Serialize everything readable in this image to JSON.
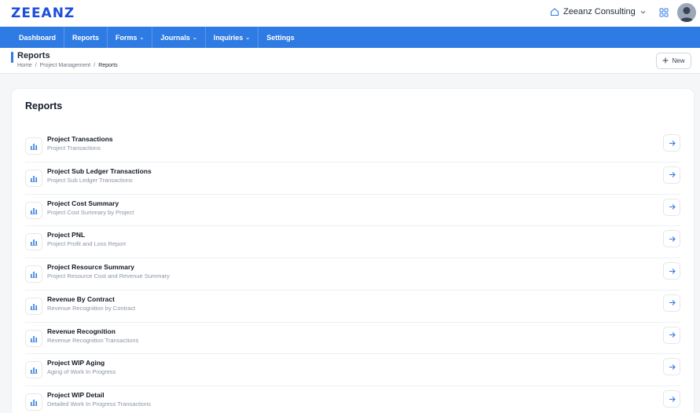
{
  "app": {
    "logo": "ZEEANZ"
  },
  "header": {
    "company_name": "Zeeanz Consulting"
  },
  "nav": {
    "items": [
      {
        "label": "Dashboard",
        "dropdown": false
      },
      {
        "label": "Reports",
        "dropdown": false
      },
      {
        "label": "Forms",
        "dropdown": true
      },
      {
        "label": "Journals",
        "dropdown": true
      },
      {
        "label": "Inquiries",
        "dropdown": true
      },
      {
        "label": "Settings",
        "dropdown": false
      }
    ]
  },
  "page": {
    "title": "Reports",
    "breadcrumb": [
      "Home",
      "Project Management",
      "Reports"
    ],
    "breadcrumb_separator": "/",
    "new_button_label": "New"
  },
  "card": {
    "title": "Reports",
    "reports": [
      {
        "title": "Project Transactions",
        "subtitle": "Project Transactions"
      },
      {
        "title": "Project Sub Ledger Transactions",
        "subtitle": "Project Sub Ledger Transactions"
      },
      {
        "title": "Project Cost Summary",
        "subtitle": "Project Cost Summary by Project"
      },
      {
        "title": "Project PNL",
        "subtitle": "Project Profit and Loss Report"
      },
      {
        "title": "Project Resource Summary",
        "subtitle": "Project Resource Cost and Revenue Summary"
      },
      {
        "title": "Revenue By Contract",
        "subtitle": "Revenue Recognition by Contract"
      },
      {
        "title": "Revenue Recognition",
        "subtitle": "Revenue Recognition Transactions"
      },
      {
        "title": "Project WIP Aging",
        "subtitle": "Aging of Work In Progress"
      },
      {
        "title": "Project WIP Detail",
        "subtitle": "Detailed Work In Progress Transactions"
      }
    ]
  },
  "colors": {
    "brand": "#1d4ed8",
    "nav_background": "#2f7be4",
    "page_background": "#f5f6f8",
    "icon_accent": "#2f7be4"
  },
  "icons": {
    "company": "home-icon",
    "company_dropdown": "chevron-down-icon",
    "apps": "grid-icon",
    "new": "plus-icon",
    "report": "bar-chart-icon",
    "open_report": "arrow-right-icon"
  }
}
